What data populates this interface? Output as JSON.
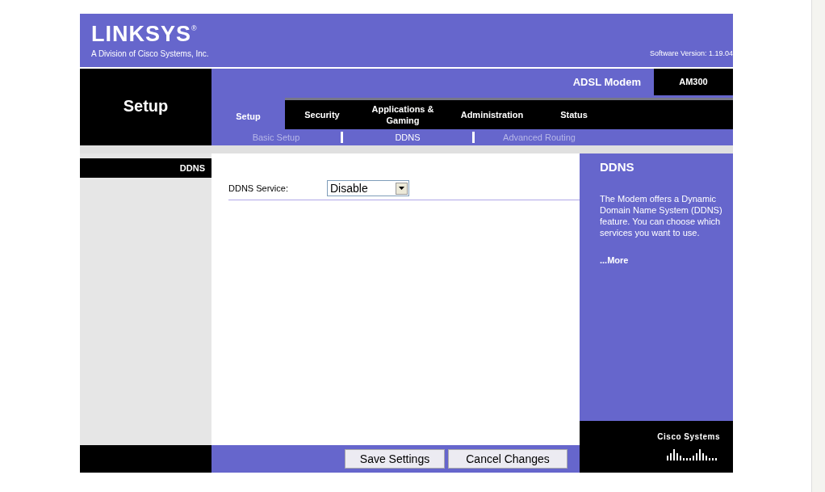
{
  "header": {
    "logo": "LINKSYS",
    "logo_mark": "®",
    "tagline": "A Division of Cisco Systems, Inc.",
    "software_version": "Software Version: 1.19.04"
  },
  "section_title": "Setup",
  "product": {
    "name": "ADSL Modem",
    "model": "AM300"
  },
  "tabs": [
    {
      "label": "Setup",
      "selected": true
    },
    {
      "label": "Security",
      "selected": false
    },
    {
      "label": "Applications & Gaming",
      "selected": false
    },
    {
      "label": "Administration",
      "selected": false
    },
    {
      "label": "Status",
      "selected": false
    }
  ],
  "subtabs": [
    {
      "label": "Basic Setup",
      "selected": false
    },
    {
      "label": "DDNS",
      "selected": true
    },
    {
      "label": "Advanced Routing",
      "selected": false
    }
  ],
  "sidebar_heading": "DDNS",
  "form": {
    "fields": [
      {
        "label": "DDNS Service:",
        "value": "Disable"
      }
    ]
  },
  "help": {
    "title": "DDNS",
    "text": "The Modem offers a Dynamic Domain Name System (DDNS) feature. You can choose which services you want to use.",
    "more": "...More"
  },
  "buttons": [
    "Save Settings",
    "Cancel Changes"
  ],
  "brand": "Cisco Systems"
}
